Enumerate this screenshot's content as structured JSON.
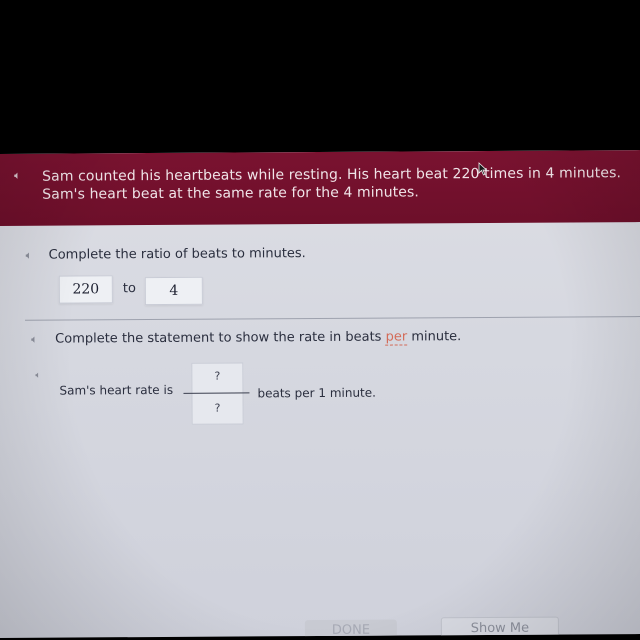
{
  "header": {
    "speaker_icon": "speaker-icon",
    "problem_line1": "Sam counted his heartbeats while resting. His heart beat 220 times in 4 minutes.",
    "problem_line2": "Sam's heart beat at the same rate for the 4 minutes."
  },
  "question1": {
    "speaker_icon": "speaker-icon",
    "prompt": "Complete the ratio of beats to minutes.",
    "beats_value": "220",
    "to_label": "to",
    "minutes_value": "4"
  },
  "question2": {
    "speaker_icon": "speaker-icon",
    "prompt_before": "Complete the statement to show the rate in beats ",
    "prompt_highlight": "per",
    "prompt_after": " minute.",
    "statement_prefix": "Sam's heart rate is",
    "numerator_placeholder": "?",
    "denominator_placeholder": "?",
    "statement_suffix": "beats per 1 minute."
  },
  "footer": {
    "done_label": "DONE",
    "show_me_label": "Show Me"
  },
  "colors": {
    "header_bg": "#7a1230",
    "content_bg": "#d6d8e0",
    "highlight_word": "#d36a57"
  },
  "cursor_icon": "mouse-pointer-icon"
}
